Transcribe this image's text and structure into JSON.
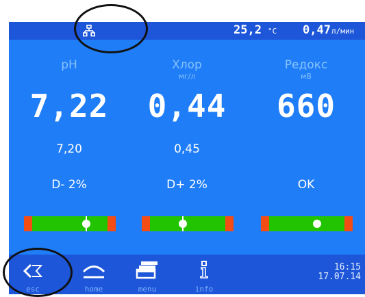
{
  "header": {
    "network_icon": "network-icon",
    "temperature": "25,2",
    "temperature_unit": "°C",
    "flow": "0,47",
    "flow_unit": "л/мин"
  },
  "channels": [
    {
      "name": "pH",
      "unit": "",
      "value": "7,22",
      "setpoint": "7,20",
      "status": "D- 2%",
      "bar_marker": 0.68
    },
    {
      "name": "Хлор",
      "unit": "мг/л",
      "value": "0,44",
      "setpoint": "0,45",
      "status": "D+ 2%",
      "bar_marker": 0.45
    },
    {
      "name": "Редокс",
      "unit": "мВ",
      "value": "660",
      "setpoint": "",
      "status": "OK",
      "bar_marker": 0.61
    }
  ],
  "nav": [
    {
      "label": "esc",
      "icon": "back-icon"
    },
    {
      "label": "home",
      "icon": "home-icon"
    },
    {
      "label": "menu",
      "icon": "menu-icon"
    },
    {
      "label": "info",
      "icon": "info-icon"
    }
  ],
  "clock": {
    "time": "16:15",
    "date": "17.07.14"
  },
  "colors": {
    "screen": "#1f7df7",
    "bars": "#1d56d8",
    "bar_ok": "#22c400",
    "bar_limit": "#f34c14",
    "label": "#86c2ff"
  }
}
